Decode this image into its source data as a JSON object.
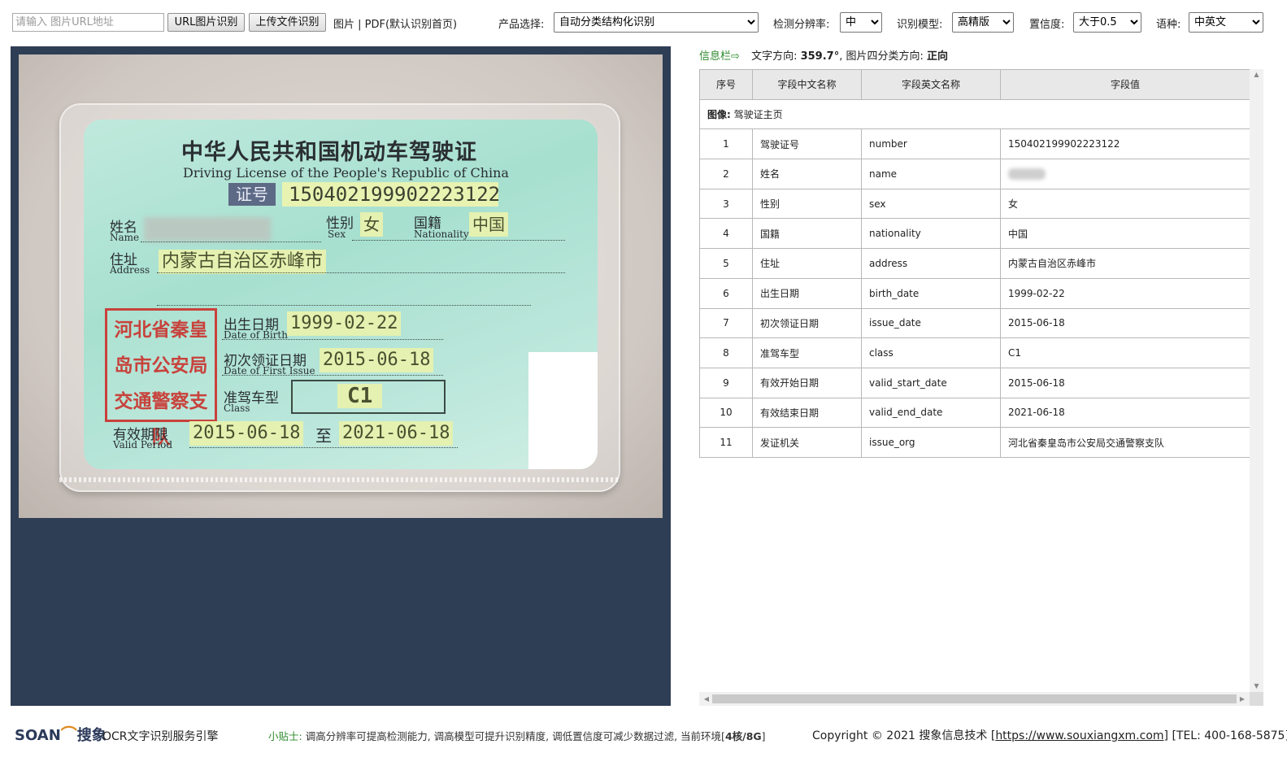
{
  "toolbar": {
    "url_placeholder": "请输入 图片URL地址",
    "url_button": "URL图片识别",
    "upload_button": "上传文件识别",
    "format_hint": "图片 | PDF(默认识别首页)",
    "product_label": "产品选择:",
    "product_value": "自动分类结构化识别",
    "resolution_label": "检测分辨率:",
    "resolution_value": "中",
    "model_label": "识别模型:",
    "model_value": "高精版",
    "confidence_label": "置信度:",
    "confidence_value": "大于0.5",
    "language_label": "语种:",
    "language_value": "中英文"
  },
  "card": {
    "title": "中华人民共和国机动车驾驶证",
    "subtitle": "Driving License of the People's Republic of China",
    "cert_no_label": "证号",
    "cert_no": "150402199902223122",
    "name_cn": "姓名",
    "name_en": "Name",
    "sex_cn": "性别",
    "sex_en": "Sex",
    "sex_value": "女",
    "nationality_cn": "国籍",
    "nationality_en": "Nationality",
    "nationality_value": "中国",
    "address_cn": "住址",
    "address_en": "Address",
    "address_value": "内蒙古自治区赤峰市",
    "seal_line1": "河北省秦皇",
    "seal_line2": "岛市公安局",
    "seal_line3": "交通警察支队",
    "dob_cn": "出生日期",
    "dob_en": "Date of Birth",
    "dob_value": "1999-02-22",
    "first_issue_cn": "初次领证日期",
    "first_issue_en": "Date of First Issue",
    "first_issue_value": "2015-06-18",
    "class_cn": "准驾车型",
    "class_en": "Class",
    "class_value": "C1",
    "valid_cn": "有效期限",
    "valid_en": "Valid Period",
    "valid_start": "2015-06-18",
    "valid_to": "至",
    "valid_end": "2021-06-18"
  },
  "info": {
    "title": "信息栏",
    "arrow": "⇨",
    "text_direction_label": "文字方向:",
    "text_direction_value": "359.7°",
    "orientation_label": ", 图片四分类方向:",
    "orientation_value": "正向"
  },
  "table": {
    "headers": [
      "序号",
      "字段中文名称",
      "字段英文名称",
      "字段值"
    ],
    "group_label": "图像:",
    "group_value": "驾驶证主页",
    "rows": [
      {
        "idx": "1",
        "cn": "驾驶证号",
        "en": "number",
        "value": "150402199902223122"
      },
      {
        "idx": "2",
        "cn": "姓名",
        "en": "name",
        "value": ""
      },
      {
        "idx": "3",
        "cn": "性别",
        "en": "sex",
        "value": "女"
      },
      {
        "idx": "4",
        "cn": "国籍",
        "en": "nationality",
        "value": "中国"
      },
      {
        "idx": "5",
        "cn": "住址",
        "en": "address",
        "value": "内蒙古自治区赤峰市"
      },
      {
        "idx": "6",
        "cn": "出生日期",
        "en": "birth_date",
        "value": "1999-02-22"
      },
      {
        "idx": "7",
        "cn": "初次领证日期",
        "en": "issue_date",
        "value": "2015-06-18"
      },
      {
        "idx": "8",
        "cn": "准驾车型",
        "en": "class",
        "value": "C1"
      },
      {
        "idx": "9",
        "cn": "有效开始日期",
        "en": "valid_start_date",
        "value": "2015-06-18"
      },
      {
        "idx": "10",
        "cn": "有效结束日期",
        "en": "valid_end_date",
        "value": "2021-06-18"
      },
      {
        "idx": "11",
        "cn": "发证机关",
        "en": "issue_org",
        "value": "河北省秦皇岛市公安局交通警察支队"
      }
    ]
  },
  "footer": {
    "logo_text": "SOAN",
    "logo_cn": "搜象",
    "engine_name": "OCR文字识别服务引擎",
    "tip_label": "小贴士:",
    "tip_text": "调高分辨率可提高检测能力, 调高模型可提升识别精度, 调低置信度可减少数据过滤, 当前环境[",
    "tip_env": "4核/8G",
    "tip_end": "]",
    "copyright_prefix": "Copyright © 2021 搜象信息技术 [",
    "copyright_link": "https://www.souxiangxm.com",
    "copyright_suffix": "] [TEL: 400-168-5875]"
  }
}
